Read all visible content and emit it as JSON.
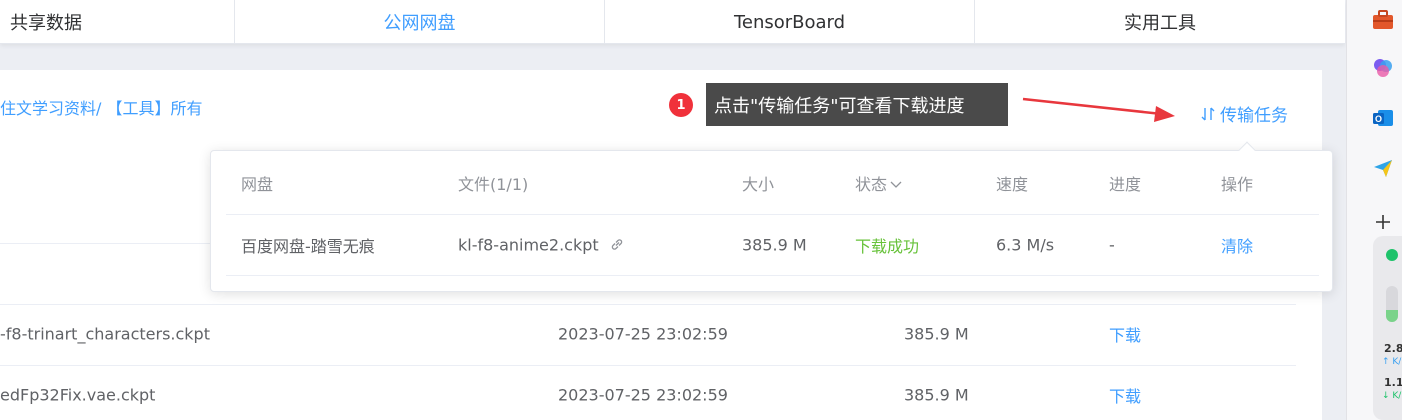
{
  "tabs": [
    {
      "label": "共享数据"
    },
    {
      "label": "公网网盘"
    },
    {
      "label": "TensorBoard"
    },
    {
      "label": "实用工具"
    }
  ],
  "path": "住文学习资料/ 【工具】所有",
  "transfer_button": {
    "label": "传输任务",
    "icon": "transfer-arrows-icon"
  },
  "annotation": {
    "badge": "1",
    "text": "点击\"传输任务\"可查看下载进度"
  },
  "popover": {
    "headers": {
      "disk": "网盘",
      "file": "文件(1/1)",
      "size": "大小",
      "status": "状态",
      "speed": "速度",
      "progress": "进度",
      "action": "操作"
    },
    "row": {
      "disk": "百度网盘-踏雪无痕",
      "file": "kl-f8-anime2.ckpt",
      "size": "385.9 M",
      "status": "下载成功",
      "speed": "6.3 M/s",
      "progress": "-",
      "action": "清除"
    }
  },
  "files": [
    {
      "name": "-f8-trinart_characters.ckpt",
      "date": "2023-07-25 23:02:59",
      "size": "385.9 M",
      "action": "下载"
    },
    {
      "name": "edFp32Fix.vae.ckpt",
      "date": "2023-07-25 23:02:59",
      "size": "385.9 M",
      "action": "下载"
    }
  ],
  "sidebar_widget": {
    "up_value": "2.8",
    "up_unit": "↑ K/",
    "down_value": "1.1",
    "down_unit": "↓ K/"
  },
  "colors": {
    "accent": "#409eff",
    "success": "#67c23a",
    "badge": "#f0313b",
    "arrow": "#e8373d"
  }
}
